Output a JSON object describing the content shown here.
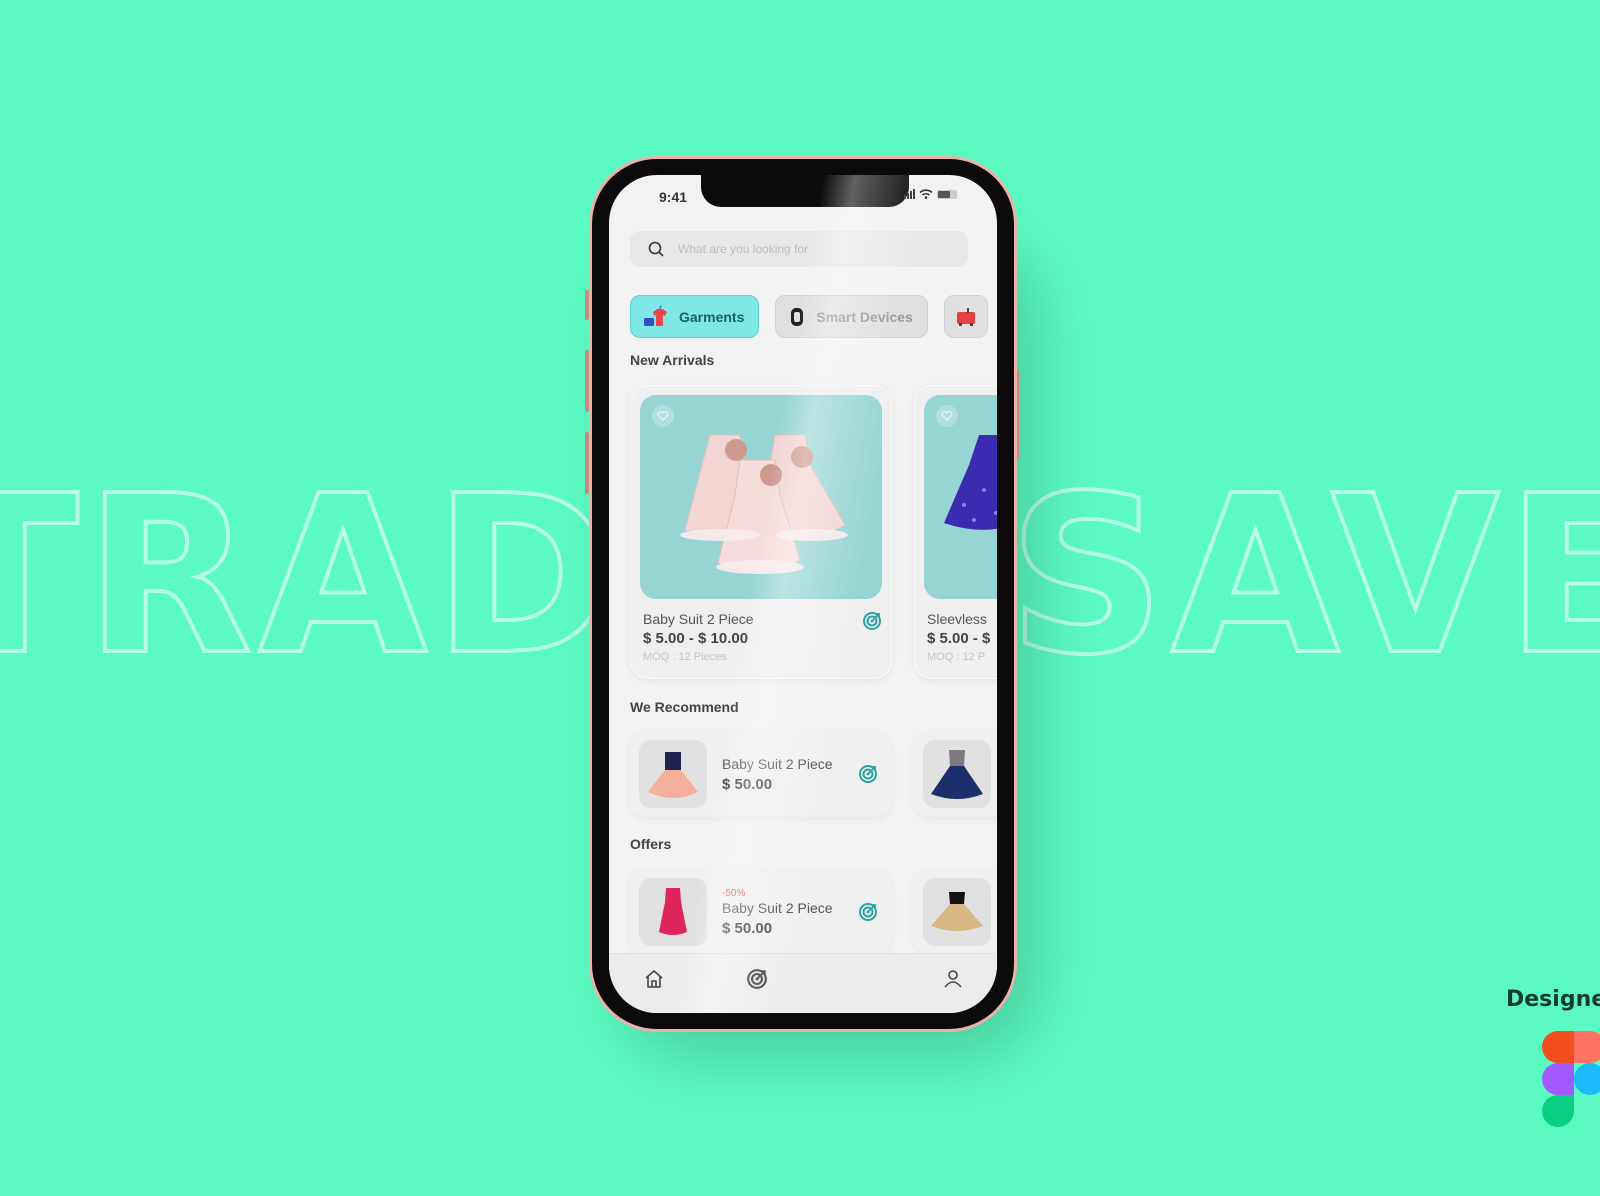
{
  "backdrop": {
    "word_left": "TRADE",
    "word_right": "SAVE"
  },
  "status_bar": {
    "time": "9:41"
  },
  "search": {
    "placeholder": "What are you looking for",
    "value": "",
    "icon": "search-icon"
  },
  "categories": [
    {
      "label": "Garments",
      "icon": "garments-icon",
      "active": true
    },
    {
      "label": "Smart Devices",
      "icon": "smartwatch-icon",
      "active": false
    },
    {
      "label": "",
      "icon": "appliance-icon",
      "active": false
    }
  ],
  "new_arrivals": {
    "title": "New Arrivals",
    "items": [
      {
        "name": "Baby Suit 2 Piece",
        "price": "$ 5.00 - $ 10.00",
        "moq": "MOQ : 12 Pieces",
        "image": "pink-dresses"
      },
      {
        "name": "Sleevless",
        "price": "$ 5.00 - $",
        "moq": "MOQ : 12 P",
        "image": "purple-dress"
      }
    ]
  },
  "recommend": {
    "title": "We Recommend",
    "items": [
      {
        "name": "Baby Suit 2 Piece",
        "price": "$ 50.00",
        "image": "peach-dress"
      },
      {
        "name": "",
        "price": "",
        "image": "navy-dress"
      }
    ]
  },
  "offers": {
    "title": "Offers",
    "items": [
      {
        "discount": "-50%",
        "name": "Baby Suit 2 Piece",
        "price": "$ 50.00",
        "image": "magenta-dress"
      },
      {
        "discount": "",
        "name": "",
        "price": "",
        "image": "gold-dress"
      }
    ]
  },
  "bottom_nav": [
    {
      "icon": "home-icon"
    },
    {
      "icon": "target-icon"
    },
    {
      "icon": "profile-icon"
    }
  ],
  "branding": {
    "designed_label": "Designed in",
    "tool": "figma-logo"
  },
  "colors": {
    "background": "#5cfac3",
    "accent_teal": "#2aa3a3",
    "chip_active": "#7fe8e6",
    "discount_red": "#e25555",
    "card_image_bg": "#97d5d5"
  }
}
